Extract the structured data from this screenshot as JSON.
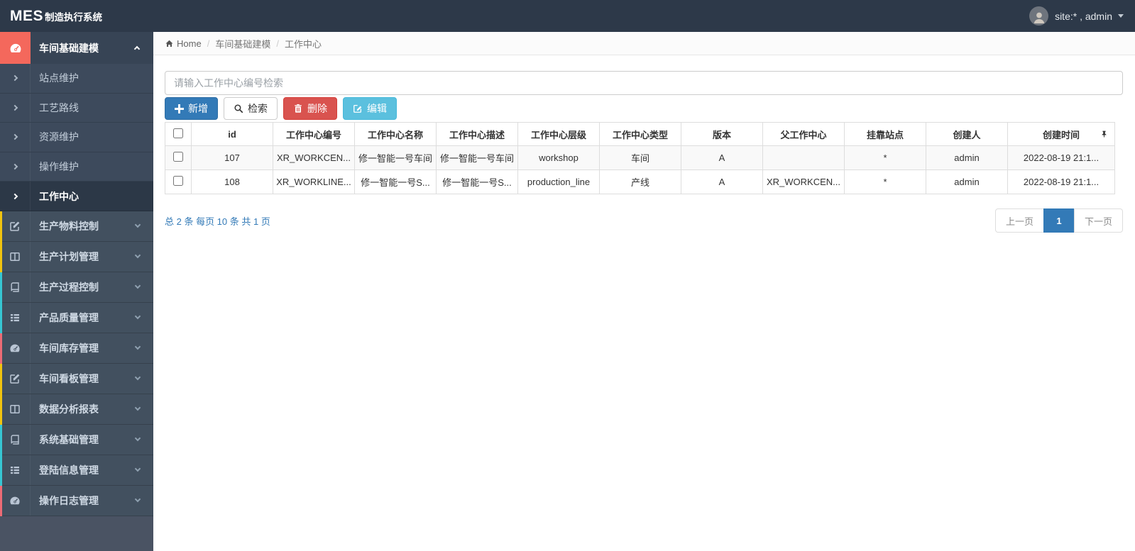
{
  "app": {
    "brand_bold": "MES",
    "brand_rest": "制造执行系统",
    "user_label": "site:* , admin"
  },
  "breadcrumb": {
    "home": "Home",
    "separator": "/",
    "level1": "车间基础建模",
    "level2": "工作中心"
  },
  "sidebar": {
    "parent_label": "车间基础建模",
    "submenu": [
      "站点维护",
      "工艺路线",
      "资源维护",
      "操作维护",
      "工作中心"
    ],
    "items": [
      "生产物料控制",
      "生产计划管理",
      "生产过程控制",
      "产品质量管理",
      "车间库存管理",
      "车间看板管理",
      "数据分析报表",
      "系统基础管理",
      "登陆信息管理",
      "操作日志管理"
    ]
  },
  "toolbar": {
    "search_placeholder": "请输入工作中心编号检索",
    "add_label": "新增",
    "search_label": "检索",
    "delete_label": "删除",
    "edit_label": "编辑"
  },
  "table": {
    "headers": [
      "id",
      "工作中心编号",
      "工作中心名称",
      "工作中心描述",
      "工作中心层级",
      "工作中心类型",
      "版本",
      "父工作中心",
      "挂靠站点",
      "创建人",
      "创建时间"
    ],
    "rows": [
      [
        "107",
        "XR_WORKCEN...",
        "修一智能一号车间",
        "修一智能一号车间",
        "workshop",
        "车间",
        "A",
        "",
        "*",
        "admin",
        "2022-08-19 21:1..."
      ],
      [
        "108",
        "XR_WORKLINE...",
        "修一智能一号S...",
        "修一智能一号S...",
        "production_line",
        "产线",
        "A",
        "XR_WORKCEN...",
        "*",
        "admin",
        "2022-08-19 21:1..."
      ]
    ]
  },
  "pagination": {
    "stats": "总 2 条  每页 10 条  共 1 页",
    "prev": "上一页",
    "current": "1",
    "next": "下一页"
  },
  "colors": {
    "primary": "#337ab7",
    "danger": "#d9534f",
    "info": "#5bc0de",
    "accent_red": "#f4685c",
    "strip_yellow": "#f1c40f",
    "strip_teal": "#36c6d3",
    "strip_red": "#ed6b75"
  }
}
